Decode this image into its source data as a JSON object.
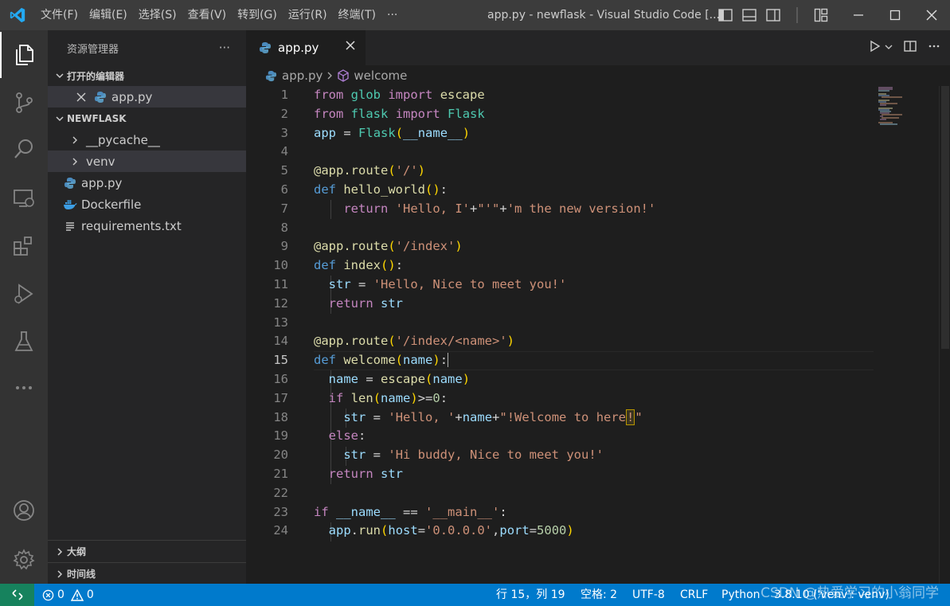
{
  "titlebar": {
    "menu": [
      "文件(F)",
      "编辑(E)",
      "选择(S)",
      "查看(V)",
      "转到(G)",
      "运行(R)",
      "终端(T)",
      "···"
    ],
    "window_title": "app.py - newflask - Visual Studio Code [..."
  },
  "sidebar": {
    "title": "资源管理器",
    "more": "···",
    "open_editors_label": "打开的编辑器",
    "open_editors": [
      {
        "name": "app.py"
      }
    ],
    "folder_label": "NEWFLASK",
    "tree": [
      {
        "name": "__pycache__",
        "kind": "folder"
      },
      {
        "name": "venv",
        "kind": "folder"
      },
      {
        "name": "app.py",
        "kind": "python"
      },
      {
        "name": "Dockerfile",
        "kind": "docker"
      },
      {
        "name": "requirements.txt",
        "kind": "text"
      }
    ],
    "outline_label": "大纲",
    "timeline_label": "时间线"
  },
  "editor": {
    "tab_label": "app.py",
    "breadcrumb_file": "app.py",
    "breadcrumb_symbol": "welcome",
    "current_line": 15,
    "line_numbers": [
      "1",
      "2",
      "3",
      "4",
      "5",
      "6",
      "7",
      "8",
      "9",
      "10",
      "11",
      "12",
      "13",
      "14",
      "15",
      "16",
      "17",
      "18",
      "19",
      "20",
      "21",
      "22",
      "23",
      "24"
    ]
  },
  "status": {
    "errors": "0",
    "warnings": "0",
    "position": "行 15，列 19",
    "indent": "空格: 2",
    "encoding": "UTF-8",
    "eol": "CRLF",
    "language": "Python",
    "interpreter": "3.8.10 ('venv': venv)"
  },
  "watermark": "CSDN @热爱学习的小翁同学",
  "colors": {
    "statusbar": "#007acc",
    "remote": "#16825d",
    "titlebar": "#3c3c3c",
    "activitybar": "#333333",
    "sidebar": "#252526",
    "editor": "#1e1e1e"
  }
}
